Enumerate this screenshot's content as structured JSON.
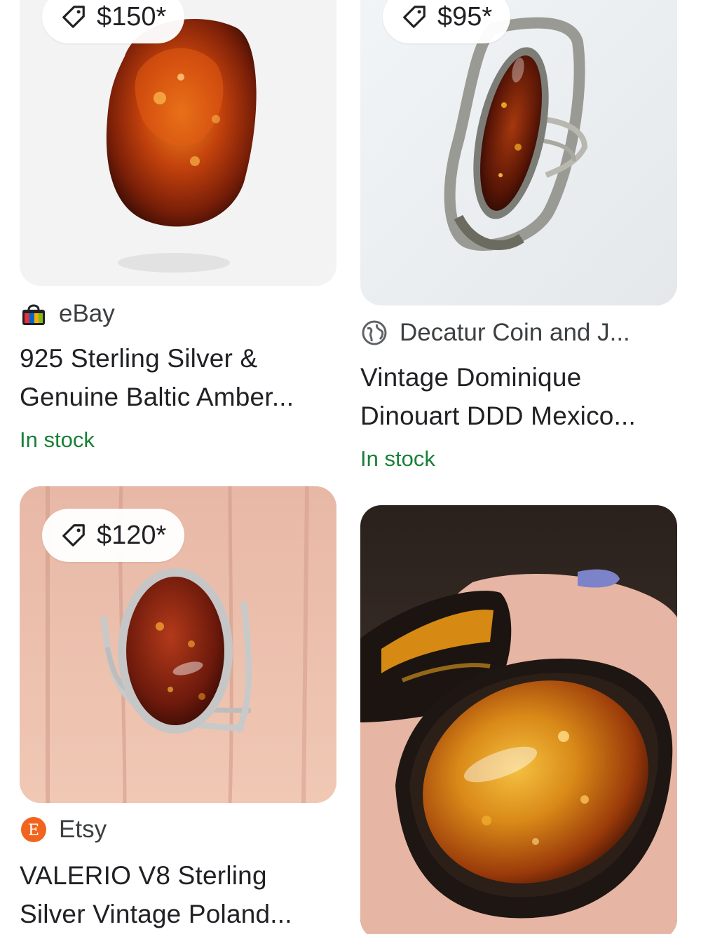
{
  "products": [
    {
      "price": "$150*",
      "source": "eBay",
      "title_lines": [
        "925 Sterling Silver &",
        "Genuine Baltic Amber..."
      ],
      "stock": "In stock"
    },
    {
      "price": "$95*",
      "source": "Decatur Coin and J...",
      "title_lines": [
        "Vintage Dominique",
        "Dinouart DDD Mexico..."
      ],
      "stock": "In stock"
    },
    {
      "price": "$120*",
      "source": "Etsy",
      "title_lines": [
        "VALERIO V8 Sterling",
        "Silver Vintage Poland..."
      ]
    },
    {}
  ],
  "colors": {
    "in_stock": "#188038",
    "etsy_orange": "#f1641e",
    "amber_dark": "#7a1f08",
    "amber_light": "#e8a020"
  },
  "icons": {
    "price": "price-tag-icon",
    "ebay": "ebay-bag-icon",
    "web": "globe-icon",
    "etsy": "etsy-icon"
  }
}
